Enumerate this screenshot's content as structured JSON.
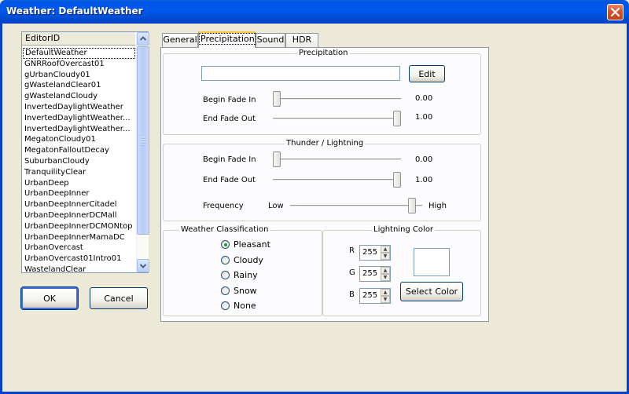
{
  "window": {
    "title": "Weather: DefaultWeather",
    "close_icon": "close-icon"
  },
  "list": {
    "header": "EditorID",
    "items": [
      "DefaultWeather",
      "GNRRoofOvercast01",
      "gUrbanCloudy01",
      "gWastelandClear01",
      "gWastelandCloudy",
      "InvertedDaylightWeather",
      "InvertedDaylightWeather...",
      "InvertedDaylightWeather...",
      "MegatonCloudy01",
      "MegatonFalloutDecay",
      "SuburbanCloudy",
      "TranquilityClear",
      "UrbanDeep",
      "UrbanDeepInner",
      "UrbanDeepInnerCitadel",
      "UrbanDeepInnerDCMall",
      "UrbanDeepInnerDCMONtop",
      "UrbanDeepInnerMamaDC",
      "UrbanOvercast",
      "UrbanOvercast01Intro01",
      "WastelandClear"
    ],
    "selected_index": 0
  },
  "buttons": {
    "ok": "OK",
    "cancel": "Cancel"
  },
  "tabs": [
    {
      "label": "General"
    },
    {
      "label": "Precipitation",
      "active": true
    },
    {
      "label": "Sound"
    },
    {
      "label": "HDR"
    }
  ],
  "precipitation": {
    "title": "Precipitation",
    "texture_value": "",
    "edit_label": "Edit",
    "begin_fade_in_label": "Begin Fade In",
    "begin_fade_in_value": "0.00",
    "begin_fade_in_level": 0.0,
    "end_fade_out_label": "End Fade Out",
    "end_fade_out_value": "1.00",
    "end_fade_out_level": 1.0
  },
  "thunder": {
    "title": "Thunder / Lightning",
    "begin_fade_in_label": "Begin Fade In",
    "begin_fade_in_value": "0.00",
    "begin_fade_in_level": 0.0,
    "end_fade_out_label": "End Fade Out",
    "end_fade_out_value": "1.00",
    "end_fade_out_level": 1.0,
    "frequency_label": "Frequency",
    "low_label": "Low",
    "high_label": "High",
    "frequency_level": 0.95
  },
  "classification": {
    "title": "Weather Classification",
    "options": [
      "Pleasant",
      "Cloudy",
      "Rainy",
      "Snow",
      "None"
    ],
    "selected": "Pleasant"
  },
  "lightning_color": {
    "title": "Lightning Color",
    "r_label": "R",
    "r_value": "255",
    "g_label": "G",
    "g_value": "255",
    "b_label": "B",
    "b_value": "255",
    "swatch_color": "#FFFFFF",
    "select_label": "Select Color"
  },
  "colors": {
    "titlebar": "#0054E3",
    "dialog_bg": "#ECE9D8",
    "panel_bg": "#FCFCFE",
    "active_tab_accent": "#FFC83C"
  }
}
